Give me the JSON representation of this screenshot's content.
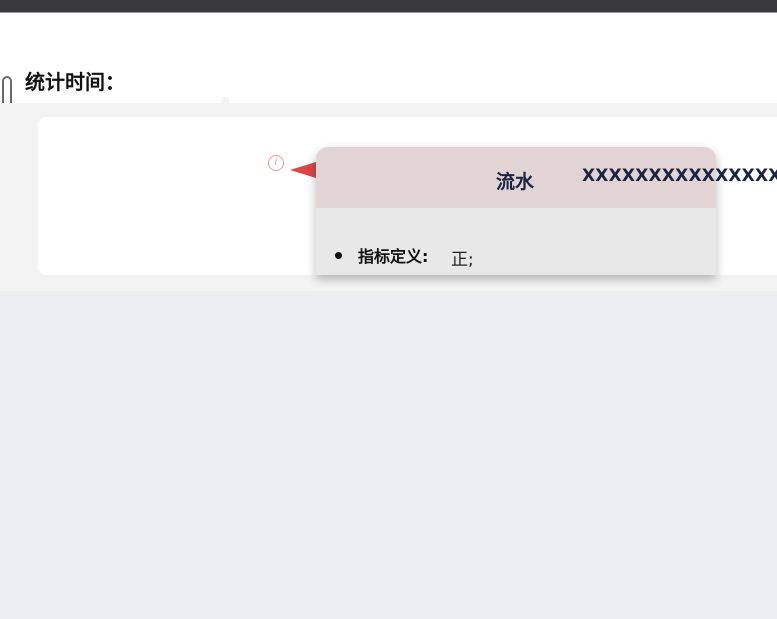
{
  "header": {
    "stat_time_label": "统计时间："
  },
  "popup": {
    "title": "流水",
    "overflow_text": "XXXXXXXXXXXXXXXXXX",
    "definition_label": "指标定义:",
    "definition_value": "正;"
  },
  "colors": {
    "popup_header": "#e2d4d4",
    "popup_body": "#e8e8e8",
    "tooltip_arrow": "#d84848",
    "scroll_thumb": "#f0a35a",
    "page_bg": "#eceef1"
  },
  "icons": {
    "info": "info-icon"
  }
}
